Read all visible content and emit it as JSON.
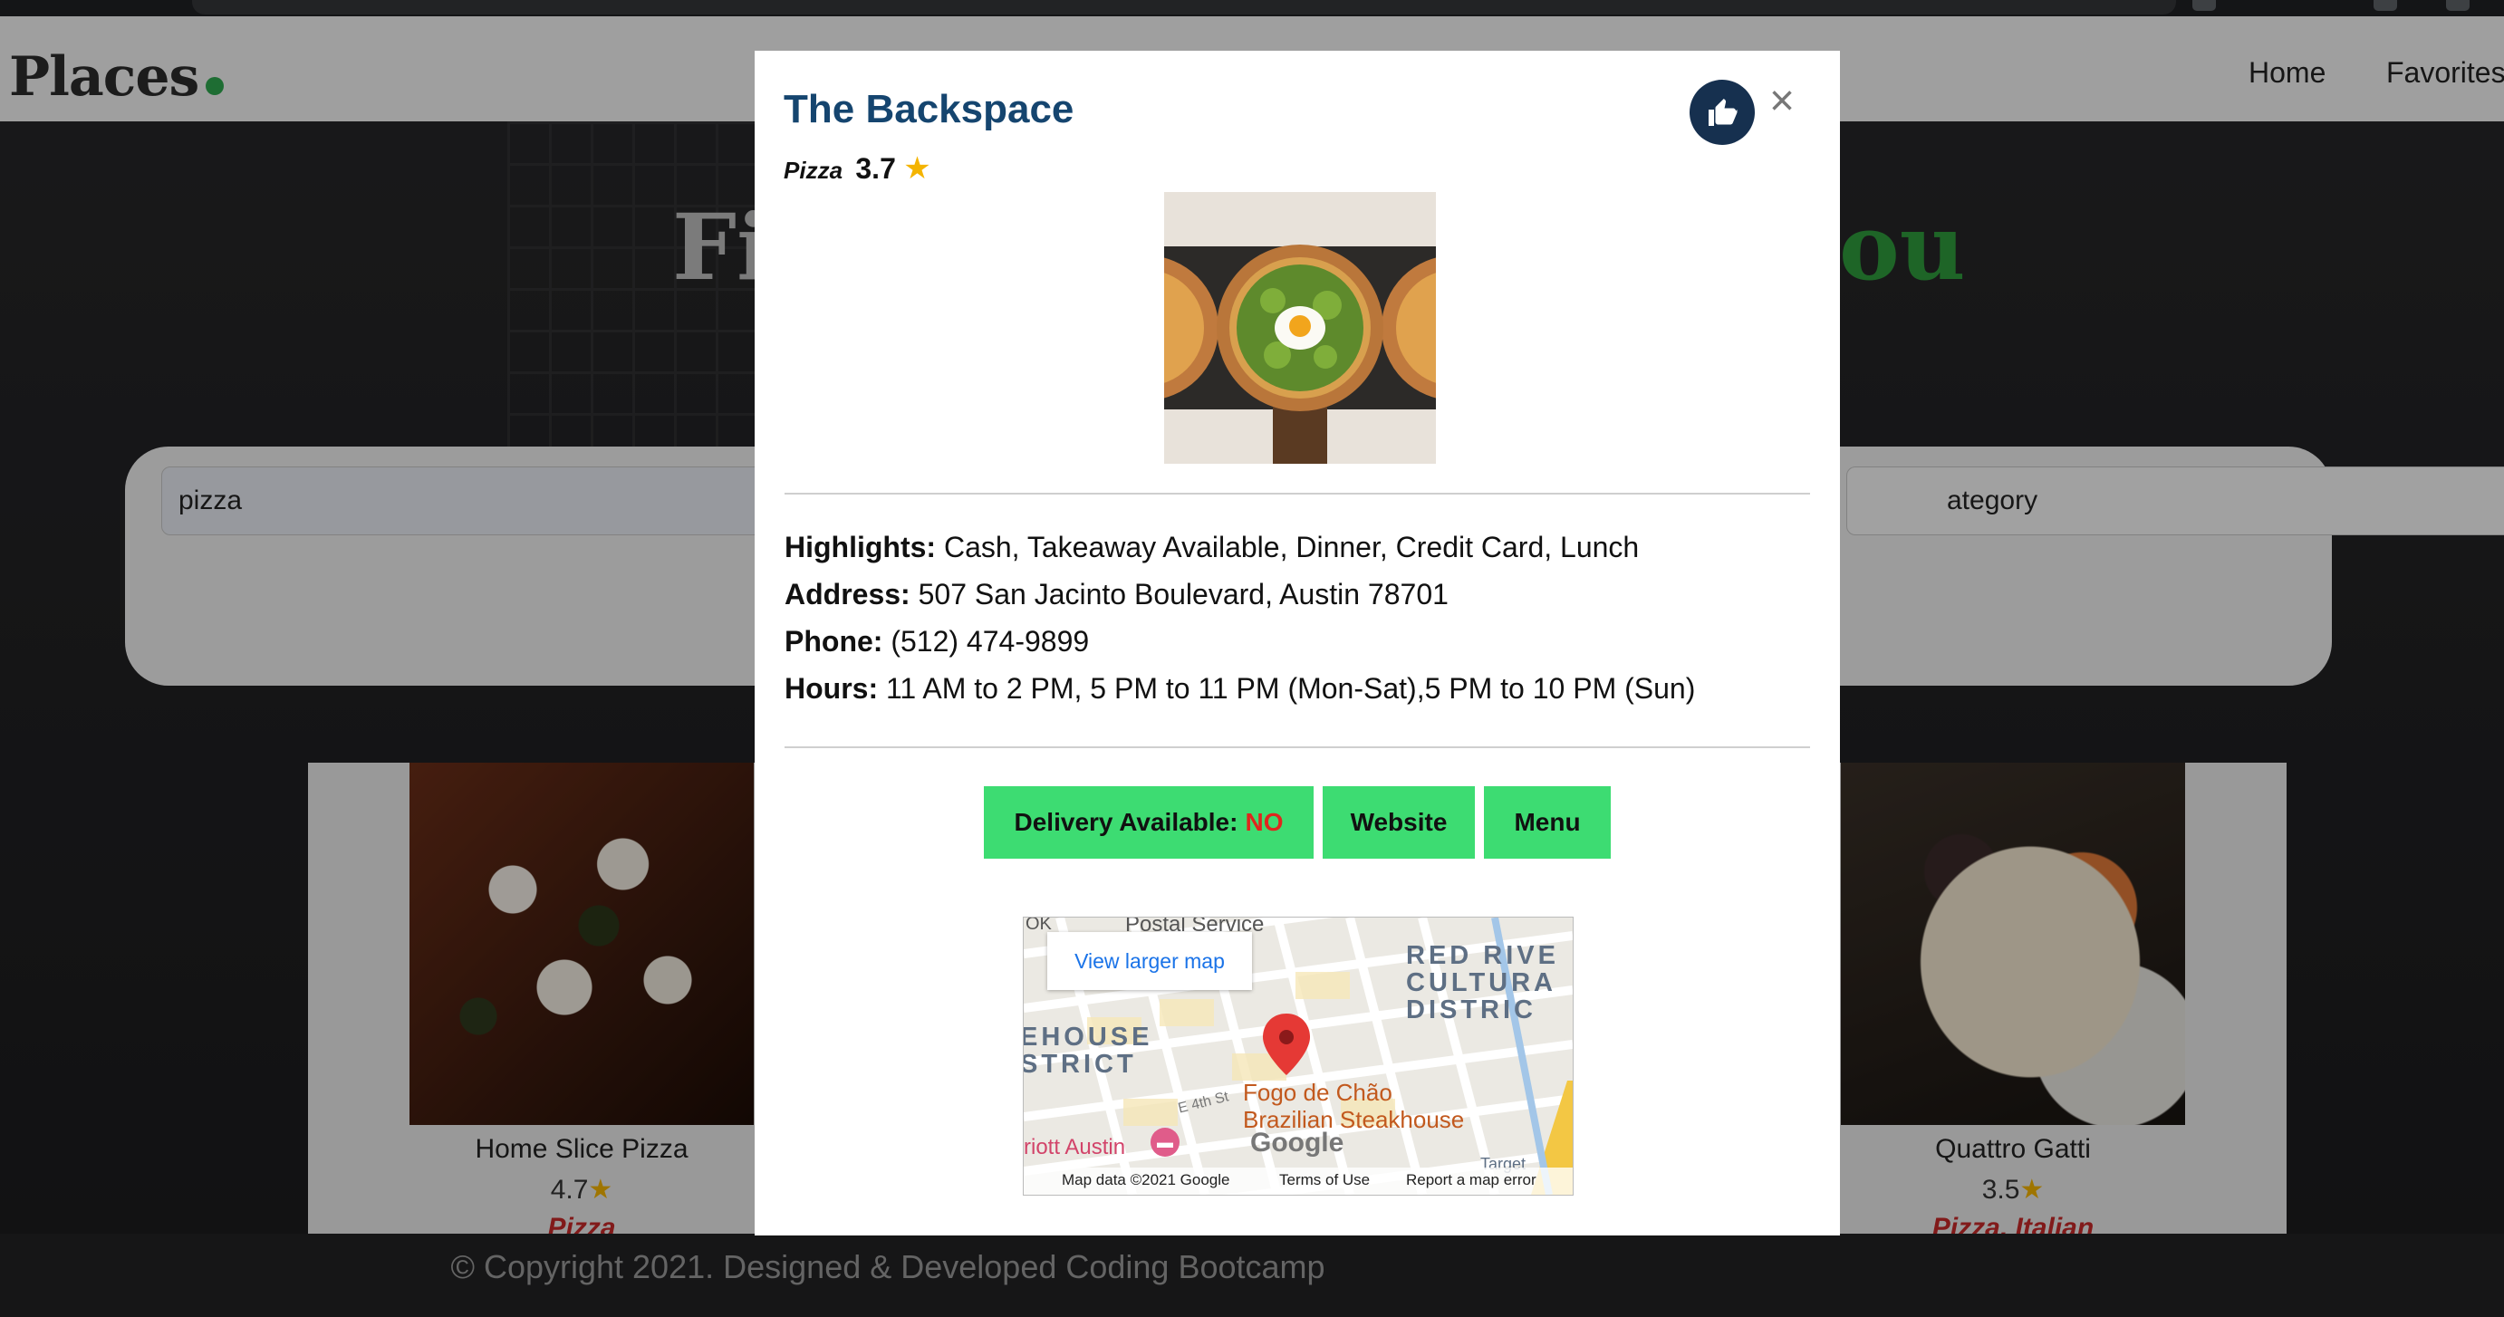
{
  "navbar": {
    "brand": "Places",
    "links": [
      "Home",
      "Favorites"
    ]
  },
  "hero": {
    "left_fragment": "Fi",
    "right_fragment": "ou"
  },
  "search": {
    "query": "pizza",
    "category_placeholder_visible": "ategory"
  },
  "results": [
    {
      "name": "Home Slice Pizza",
      "rating": "4.7",
      "category": "Pizza"
    },
    {
      "name": "Quattro Gatti",
      "rating": "3.5",
      "category": "Pizza, Italian"
    }
  ],
  "footer": {
    "text": "© Copyright 2021. Designed & Developed Coding Bootcamp"
  },
  "modal": {
    "title": "The Backspace",
    "category": "Pizza",
    "rating": "3.7",
    "close_symbol": "×",
    "highlights_label": "Highlights:",
    "highlights": "Cash, Takeaway Available, Dinner, Credit Card, Lunch",
    "address_label": "Address:",
    "address": "507 San Jacinto Boulevard, Austin 78701",
    "phone_label": "Phone:",
    "phone": "(512) 474-9899",
    "hours_label": "Hours:",
    "hours": "11 AM to 2 PM, 5 PM to 11 PM (Mon-Sat),5 PM to 10 PM (Sun)",
    "delivery_label": "Delivery Available:",
    "delivery_value": "NO",
    "website_label": "Website",
    "menu_label": "Menu"
  },
  "map": {
    "view_larger": "View larger map",
    "postal": "Postal Service",
    "postal_prefix": "OK",
    "district_right": [
      "RED RIVE",
      "CULTURA",
      "DISTRIC"
    ],
    "district_left": [
      "EHOUSE",
      "STRICT"
    ],
    "street": "E 4th St",
    "poi_lines": [
      "Fogo de Chão",
      "Brazilian Steakhouse"
    ],
    "hotel": "riott Austin",
    "target_label": "Target",
    "google_logo": "Google",
    "map_data": "Map data ©2021 Google",
    "terms": "Terms of Use",
    "report": "Report a map error"
  },
  "colors": {
    "title_blue": "#15456f",
    "button_green": "#3ddc72",
    "no_red": "#e0261e",
    "star_yellow": "#f4b400",
    "brand_dot_green": "#2fa84f"
  }
}
